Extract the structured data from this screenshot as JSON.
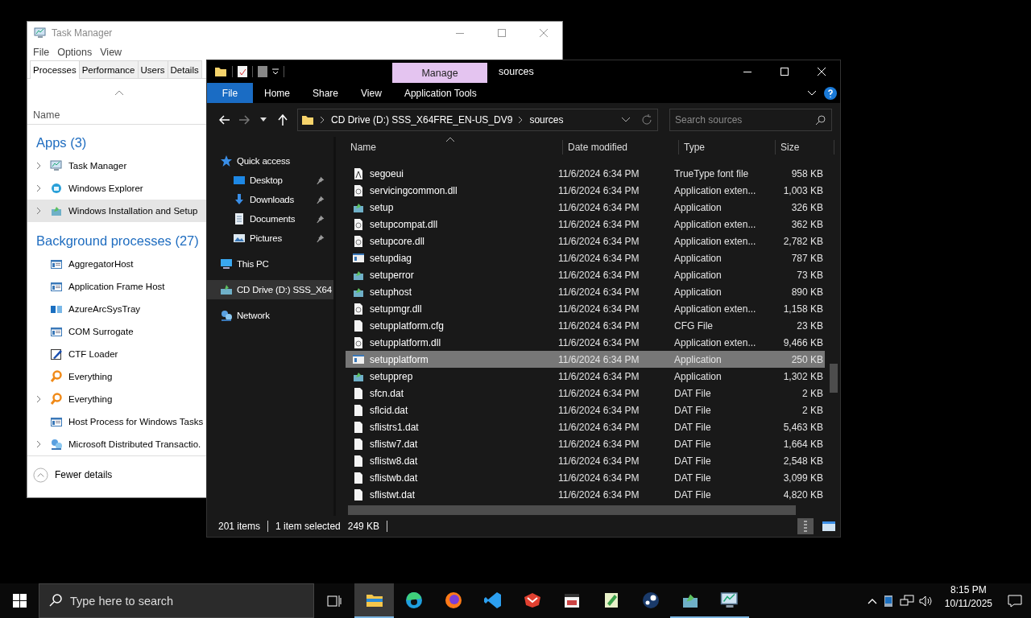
{
  "task_manager": {
    "title": "Task Manager",
    "menu": [
      "File",
      "Options",
      "View"
    ],
    "tabs": [
      {
        "label": "Processes",
        "selected": true
      },
      {
        "label": "Performance",
        "selected": false
      },
      {
        "label": "Users",
        "selected": false
      },
      {
        "label": "Details",
        "selected": false
      }
    ],
    "column": "Name",
    "groups": [
      {
        "heading": "Apps (3)",
        "items": [
          {
            "name": "Task Manager",
            "kind": "monitor",
            "expandable": true,
            "selected": false
          },
          {
            "name": "Windows Explorer",
            "kind": "explorer",
            "expandable": true,
            "selected": false
          },
          {
            "name": "Windows Installation and Setup",
            "kind": "setup",
            "expandable": true,
            "selected": true
          }
        ]
      },
      {
        "heading": "Background processes (27)",
        "items": [
          {
            "name": "AggregatorHost",
            "kind": "window",
            "expandable": false,
            "selected": false
          },
          {
            "name": "Application Frame Host",
            "kind": "window",
            "expandable": false,
            "selected": false
          },
          {
            "name": "AzureArcSysTray",
            "kind": "tray",
            "expandable": false,
            "selected": false
          },
          {
            "name": "COM Surrogate",
            "kind": "window",
            "expandable": false,
            "selected": false
          },
          {
            "name": "CTF Loader",
            "kind": "pen",
            "expandable": false,
            "selected": false
          },
          {
            "name": "Everything",
            "kind": "search",
            "expandable": false,
            "selected": false
          },
          {
            "name": "Everything",
            "kind": "search",
            "expandable": true,
            "selected": false
          },
          {
            "name": "Host Process for Windows Tasks",
            "kind": "window",
            "expandable": false,
            "selected": false
          },
          {
            "name": "Microsoft Distributed Transactio.",
            "kind": "network",
            "expandable": true,
            "selected": false
          }
        ]
      }
    ],
    "footer": "Fewer details"
  },
  "explorer": {
    "context_tab": "Manage",
    "title": "sources",
    "ribbon_tabs": [
      {
        "label": "File",
        "kind": "file"
      },
      {
        "label": "Home",
        "kind": "tab"
      },
      {
        "label": "Share",
        "kind": "tab"
      },
      {
        "label": "View",
        "kind": "tab"
      },
      {
        "label": "Application Tools",
        "kind": "context"
      }
    ],
    "breadcrumb": [
      "CD Drive (D:) SSS_X64FRE_EN-US_DV9",
      "sources"
    ],
    "search": {
      "placeholder": "Search sources"
    },
    "nav": [
      {
        "label": "Quick access",
        "kind": "star",
        "selected": false,
        "children": [
          {
            "label": "Desktop",
            "kind": "desktop",
            "pinned": true,
            "selected": false
          },
          {
            "label": "Downloads",
            "kind": "download",
            "pinned": true,
            "selected": false
          },
          {
            "label": "Documents",
            "kind": "document",
            "pinned": true,
            "selected": false
          },
          {
            "label": "Pictures",
            "kind": "pictures",
            "pinned": true,
            "selected": false
          }
        ]
      },
      {
        "label": "This PC",
        "kind": "pc",
        "selected": false
      },
      {
        "label": "CD Drive (D:) SSS_X64",
        "kind": "drive",
        "selected": true
      },
      {
        "label": "Network",
        "kind": "network",
        "selected": false
      }
    ],
    "columns": [
      "Name",
      "Date modified",
      "Type",
      "Size"
    ],
    "rows": [
      {
        "name": "segoeui",
        "date": "11/6/2024 6:34 PM",
        "type": "TrueType font file",
        "size": "958 KB",
        "kind": "font",
        "selected": false
      },
      {
        "name": "servicingcommon.dll",
        "date": "11/6/2024 6:34 PM",
        "type": "Application exten...",
        "size": "1,003 KB",
        "kind": "dll",
        "selected": false
      },
      {
        "name": "setup",
        "date": "11/6/2024 6:34 PM",
        "type": "Application",
        "size": "326 KB",
        "kind": "setup",
        "selected": false
      },
      {
        "name": "setupcompat.dll",
        "date": "11/6/2024 6:34 PM",
        "type": "Application exten...",
        "size": "362 KB",
        "kind": "dll",
        "selected": false
      },
      {
        "name": "setupcore.dll",
        "date": "11/6/2024 6:34 PM",
        "type": "Application exten...",
        "size": "2,782 KB",
        "kind": "dll",
        "selected": false
      },
      {
        "name": "setupdiag",
        "date": "11/6/2024 6:34 PM",
        "type": "Application",
        "size": "787 KB",
        "kind": "app",
        "selected": false
      },
      {
        "name": "setuperror",
        "date": "11/6/2024 6:34 PM",
        "type": "Application",
        "size": "73 KB",
        "kind": "setup",
        "selected": false
      },
      {
        "name": "setuphost",
        "date": "11/6/2024 6:34 PM",
        "type": "Application",
        "size": "890 KB",
        "kind": "setup",
        "selected": false
      },
      {
        "name": "setupmgr.dll",
        "date": "11/6/2024 6:34 PM",
        "type": "Application exten...",
        "size": "1,158 KB",
        "kind": "dll",
        "selected": false
      },
      {
        "name": "setupplatform.cfg",
        "date": "11/6/2024 6:34 PM",
        "type": "CFG File",
        "size": "23 KB",
        "kind": "file",
        "selected": false
      },
      {
        "name": "setupplatform.dll",
        "date": "11/6/2024 6:34 PM",
        "type": "Application exten...",
        "size": "9,466 KB",
        "kind": "dll",
        "selected": false
      },
      {
        "name": "setupplatform",
        "date": "11/6/2024 6:34 PM",
        "type": "Application",
        "size": "250 KB",
        "kind": "app",
        "selected": true
      },
      {
        "name": "setupprep",
        "date": "11/6/2024 6:34 PM",
        "type": "Application",
        "size": "1,302 KB",
        "kind": "setup",
        "selected": false
      },
      {
        "name": "sfcn.dat",
        "date": "11/6/2024 6:34 PM",
        "type": "DAT File",
        "size": "2 KB",
        "kind": "file",
        "selected": false
      },
      {
        "name": "sflcid.dat",
        "date": "11/6/2024 6:34 PM",
        "type": "DAT File",
        "size": "2 KB",
        "kind": "file",
        "selected": false
      },
      {
        "name": "sflistrs1.dat",
        "date": "11/6/2024 6:34 PM",
        "type": "DAT File",
        "size": "5,463 KB",
        "kind": "file",
        "selected": false
      },
      {
        "name": "sflistw7.dat",
        "date": "11/6/2024 6:34 PM",
        "type": "DAT File",
        "size": "1,664 KB",
        "kind": "file",
        "selected": false
      },
      {
        "name": "sflistw8.dat",
        "date": "11/6/2024 6:34 PM",
        "type": "DAT File",
        "size": "2,548 KB",
        "kind": "file",
        "selected": false
      },
      {
        "name": "sflistwb.dat",
        "date": "11/6/2024 6:34 PM",
        "type": "DAT File",
        "size": "3,099 KB",
        "kind": "file",
        "selected": false
      },
      {
        "name": "sflistwt.dat",
        "date": "11/6/2024 6:34 PM",
        "type": "DAT File",
        "size": "4,820 KB",
        "kind": "file",
        "selected": false
      }
    ],
    "status": {
      "count": "201 items",
      "selection": "1 item selected",
      "selection_size": "249 KB"
    }
  },
  "taskbar": {
    "search": {
      "placeholder": "Type here to search"
    },
    "apps": [
      {
        "kind": "explorer",
        "active": true,
        "running": true
      },
      {
        "kind": "edge",
        "active": false,
        "running": false
      },
      {
        "kind": "firefox",
        "active": false,
        "running": false
      },
      {
        "kind": "vscode",
        "active": false,
        "running": false
      },
      {
        "kind": "redapp",
        "active": false,
        "running": false
      },
      {
        "kind": "clapper",
        "active": false,
        "running": false
      },
      {
        "kind": "notepad",
        "active": false,
        "running": false
      },
      {
        "kind": "steam",
        "active": false,
        "running": false
      },
      {
        "kind": "setup",
        "active": false,
        "running": true
      },
      {
        "kind": "monitor",
        "active": false,
        "running": true
      }
    ],
    "time": "8:15 PM",
    "date": "10/11/2025"
  }
}
